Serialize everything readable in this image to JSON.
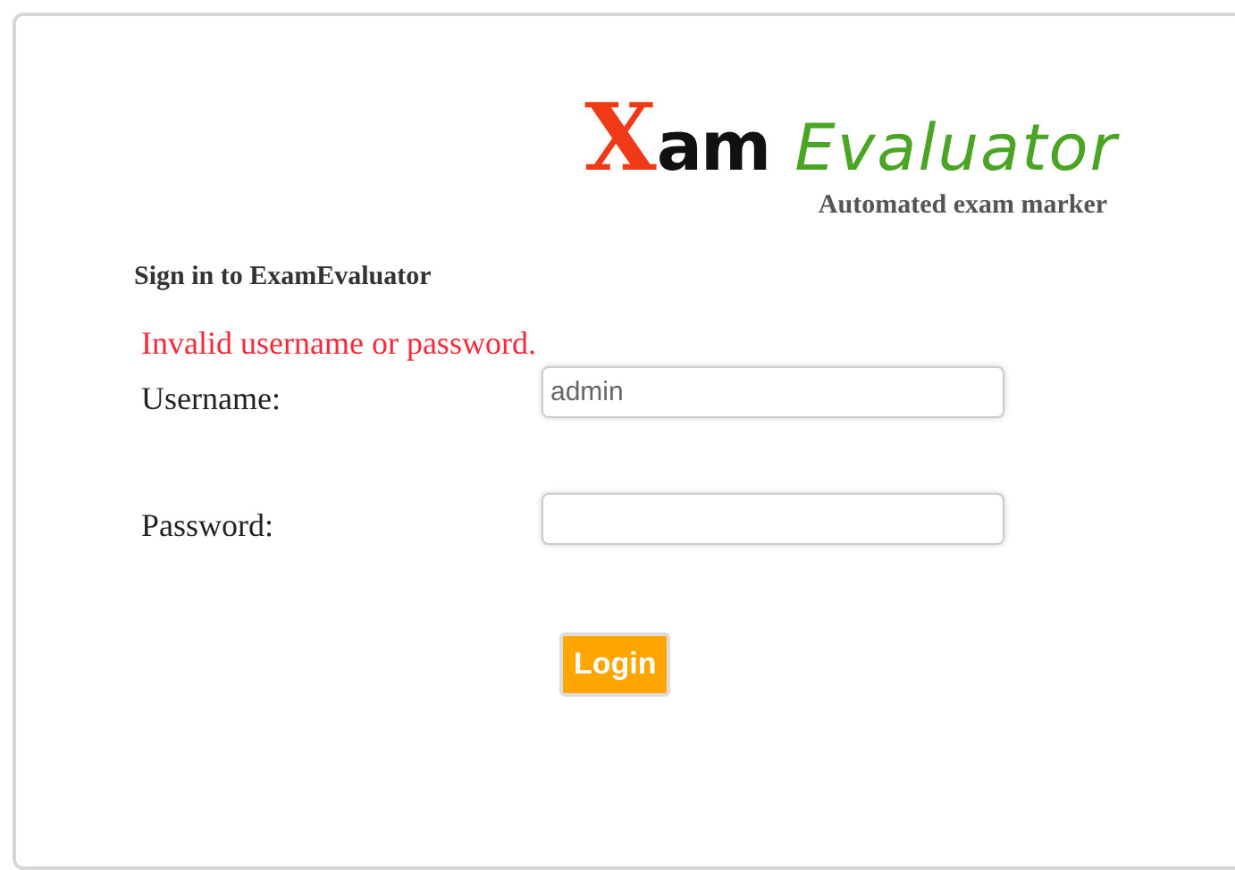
{
  "logo": {
    "initial": "X",
    "rest": "am",
    "script": "Evaluator",
    "tagline": "Automated exam marker"
  },
  "heading": "Sign in to ExamEvaluator",
  "error": "Invalid username or password.",
  "fields": [
    {
      "label": "Username:",
      "value": "admin",
      "kind": "text"
    },
    {
      "label": "Password:",
      "kind": "password"
    }
  ],
  "button": "Login"
}
